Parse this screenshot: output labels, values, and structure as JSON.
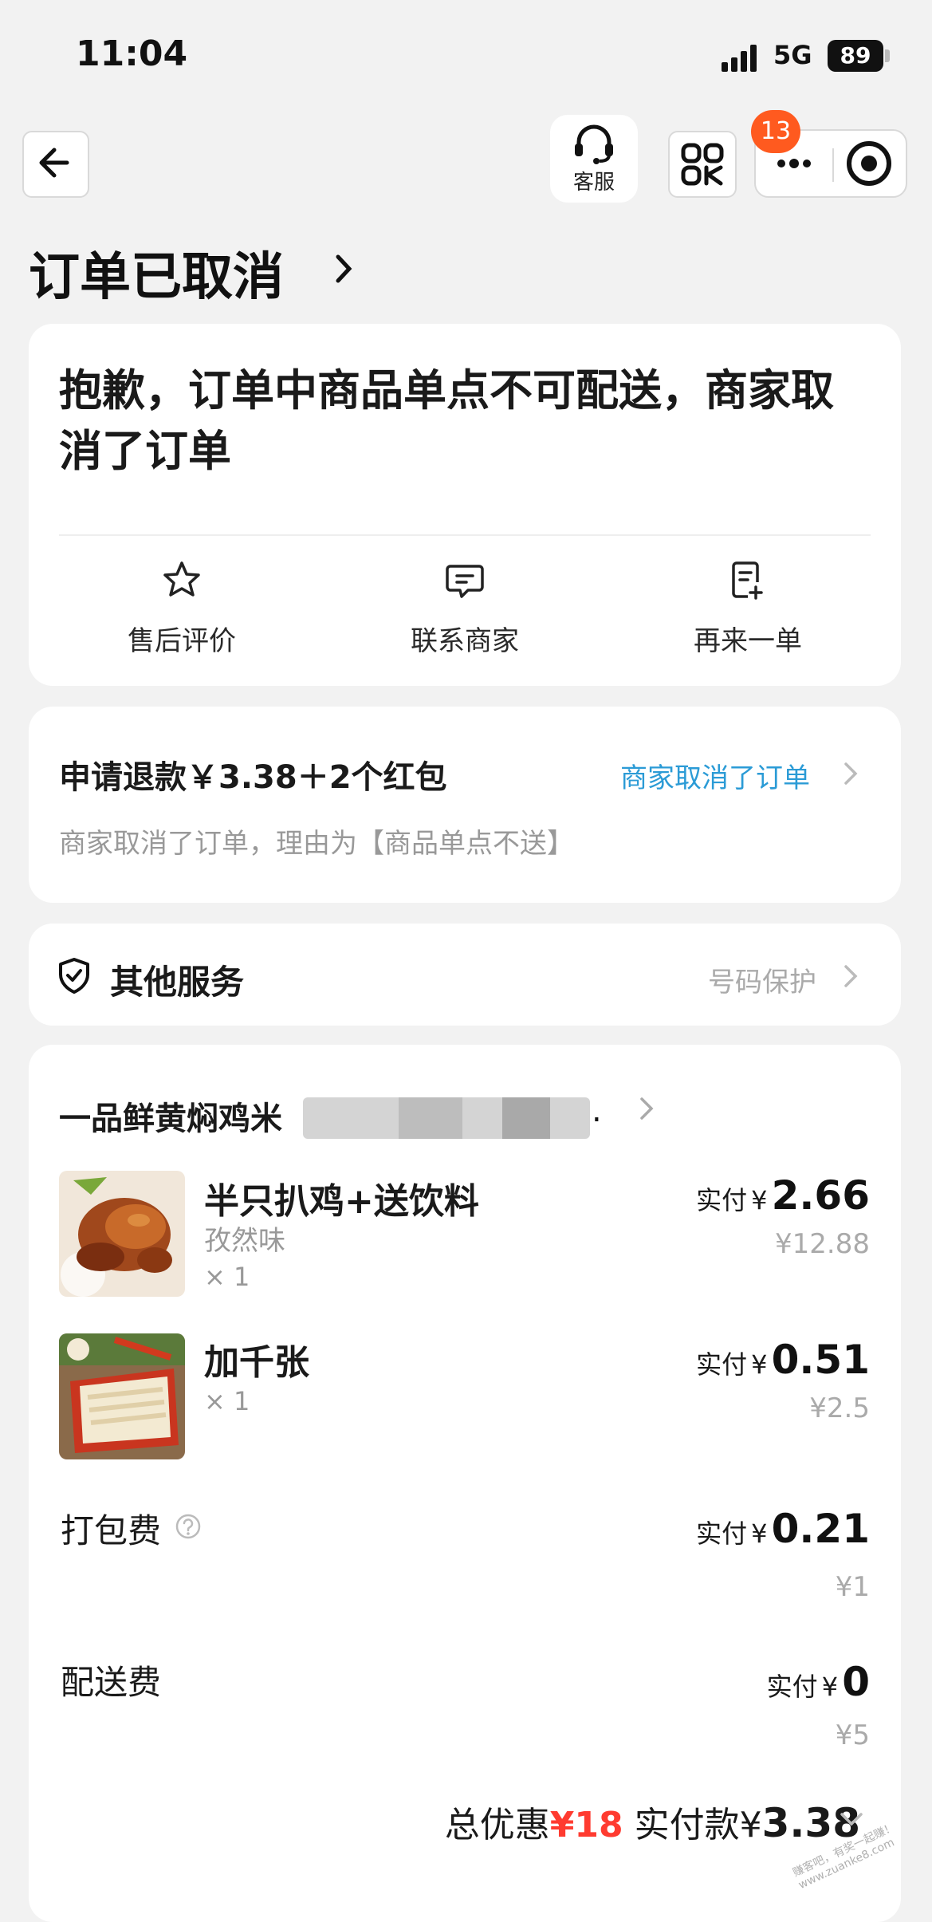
{
  "status_bar": {
    "time": "11:04",
    "network": "5G",
    "battery": "89"
  },
  "nav": {
    "service_label": "客服",
    "badge_count": "13"
  },
  "page_title": "订单已取消",
  "cancel_card": {
    "message": "抱歉，订单中商品单点不可配送，商家取消了订单",
    "actions": [
      {
        "label": "售后评价",
        "icon": "star-icon"
      },
      {
        "label": "联系商家",
        "icon": "chat-icon"
      },
      {
        "label": "再来一单",
        "icon": "reorder-icon"
      }
    ]
  },
  "refund": {
    "title": "申请退款￥3.38＋2个红包",
    "status_link": "商家取消了订单",
    "reason": "商家取消了订单，理由为【商品单点不送】"
  },
  "other_services": {
    "title": "其他服务",
    "right_text": "号码保护"
  },
  "order": {
    "shop_name": "一品鲜黄焖鸡米",
    "items": [
      {
        "name": "半只扒鸡+送饮料",
        "spec": "孜然味",
        "qty": "× 1",
        "paid_label": "实付",
        "yen": "¥",
        "paid": "2.66",
        "original": "¥12.88"
      },
      {
        "name": "加千张",
        "qty": "× 1",
        "paid_label": "实付",
        "yen": "¥",
        "paid": "0.51",
        "original": "¥2.5"
      }
    ],
    "fees": [
      {
        "name": "打包费",
        "paid_label": "实付",
        "yen": "¥",
        "paid": "0.21",
        "original": "¥1"
      },
      {
        "name": "配送费",
        "paid_label": "实付",
        "yen": "¥",
        "paid": "0",
        "original": "¥5"
      }
    ],
    "total": {
      "discount_label": "总优惠",
      "discount_value": "¥18",
      "paid_label": "实付款",
      "paid_yen": "¥",
      "paid_value": "3.38"
    }
  },
  "colors": {
    "accent_link": "#2b9bd6",
    "discount_red": "#ff3b30",
    "badge": "#ff5a1f"
  },
  "watermark": "赚客吧，有奖一起赚！www.zuanke8.com"
}
